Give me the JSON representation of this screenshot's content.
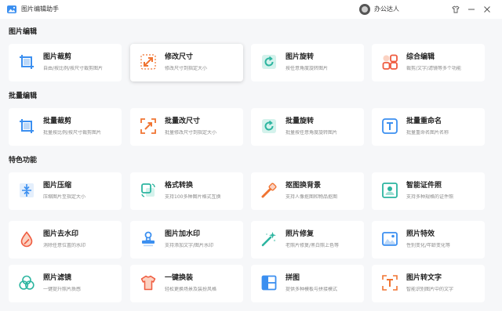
{
  "app": {
    "title": "图片编辑助手",
    "user": "办公达人"
  },
  "colors": {
    "blue": "#3b8ff0",
    "orange": "#f07432",
    "teal": "#2cb5a0",
    "red": "#ef5b3f"
  },
  "sections": [
    {
      "title": "图片编辑",
      "items": [
        {
          "name": "图片裁剪",
          "desc": "自由/按比例/按尺寸裁剪图片",
          "icon": "crop-icon"
        },
        {
          "name": "修改尺寸",
          "desc": "修改尺寸到指定大小",
          "icon": "resize-icon"
        },
        {
          "name": "图片旋转",
          "desc": "按任意角度旋转图片",
          "icon": "rotate-icon"
        },
        {
          "name": "综合编辑",
          "desc": "裁剪/文字/滤镜等多个功能",
          "icon": "grid-edit-icon"
        }
      ]
    },
    {
      "title": "批量编辑",
      "items": [
        {
          "name": "批量裁剪",
          "desc": "批量按比例/按尺寸裁剪图片",
          "icon": "batch-crop-icon"
        },
        {
          "name": "批量改尺寸",
          "desc": "批量修改尺寸到指定大小",
          "icon": "batch-resize-icon"
        },
        {
          "name": "批量旋转",
          "desc": "批量按任意角度旋转图片",
          "icon": "batch-rotate-icon"
        },
        {
          "name": "批量重命名",
          "desc": "批量重命名图片名称",
          "icon": "text-t-icon"
        }
      ]
    },
    {
      "title": "特色功能",
      "items": [
        {
          "name": "图片压缩",
          "desc": "压缩图片至指定大小",
          "icon": "compress-icon"
        },
        {
          "name": "格式转换",
          "desc": "支持100多种图片格式互换",
          "icon": "format-convert-icon"
        },
        {
          "name": "抠图换背景",
          "desc": "支持人像抠图和物品抠图",
          "icon": "cutout-icon"
        },
        {
          "name": "智能证件照",
          "desc": "支持多种规格的证件照",
          "icon": "id-photo-icon"
        },
        {
          "name": "图片去水印",
          "desc": "消除任意位置的水印",
          "icon": "remove-watermark-icon"
        },
        {
          "name": "图片加水印",
          "desc": "支持添加文字/图片水印",
          "icon": "add-watermark-icon"
        },
        {
          "name": "照片修复",
          "desc": "老照片修复/黑白照上色等",
          "icon": "magic-wand-icon"
        },
        {
          "name": "照片特效",
          "desc": "性别变化/年龄变化等",
          "icon": "photo-effect-icon"
        },
        {
          "name": "照片滤镜",
          "desc": "一键提升照片质感",
          "icon": "filter-icon"
        },
        {
          "name": "一键换装",
          "desc": "轻松更换场景及装扮风格",
          "icon": "tshirt-icon"
        },
        {
          "name": "拼图",
          "desc": "提供多种模板与拼接模式",
          "icon": "collage-icon"
        },
        {
          "name": "图片转文字",
          "desc": "智能识别图片中的文字",
          "icon": "ocr-text-icon"
        }
      ]
    }
  ]
}
